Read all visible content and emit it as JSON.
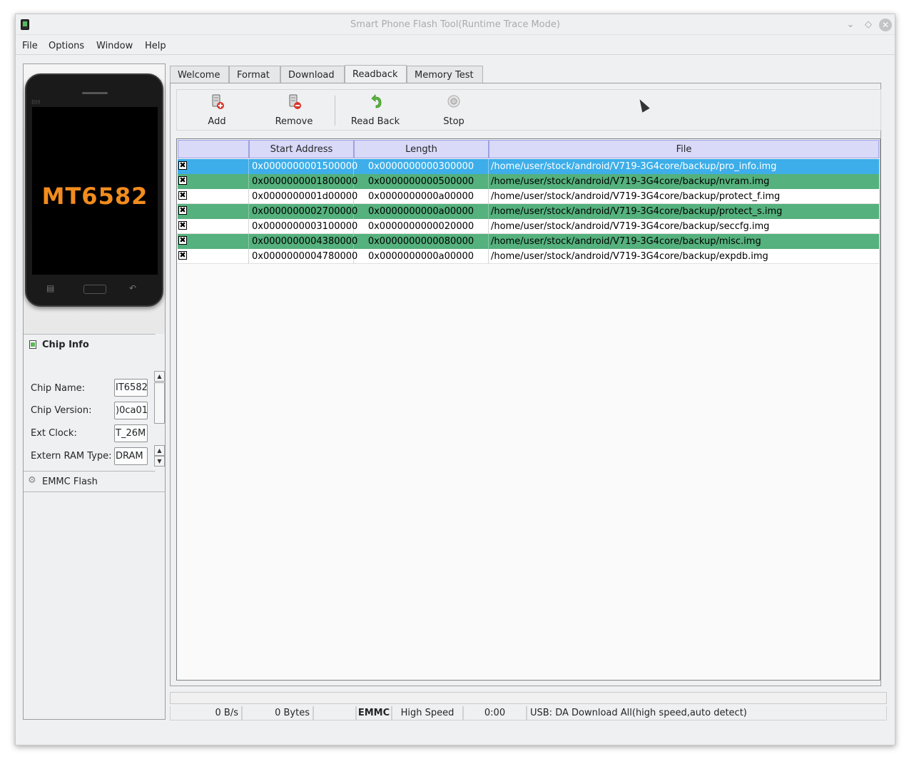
{
  "window": {
    "title": "Smart Phone Flash Tool(Runtime Trace Mode)",
    "controls": [
      "minimize",
      "restore",
      "close"
    ]
  },
  "menu": [
    "File",
    "Options",
    "Window",
    "Help"
  ],
  "phone": {
    "model": "MT6582",
    "brand": "BM"
  },
  "chip_info": {
    "title": "Chip Info",
    "fields": [
      {
        "label": "Chip Name:",
        "value": "IT6582"
      },
      {
        "label": "Chip Version:",
        "value": ")0ca01"
      },
      {
        "label": "Ext Clock:",
        "value": "T_26M"
      },
      {
        "label": "Extern RAM Type:",
        "value": "DRAM"
      }
    ]
  },
  "emmc": {
    "title": "EMMC Flash"
  },
  "tabs": [
    "Welcome",
    "Format",
    "Download",
    "Readback",
    "Memory Test"
  ],
  "active_tab": "Readback",
  "toolbar": {
    "add": "Add",
    "remove": "Remove",
    "read_back": "Read Back",
    "stop": "Stop"
  },
  "table": {
    "columns": [
      "",
      "Start Address",
      "Length",
      "File"
    ],
    "rows": [
      {
        "checked": true,
        "start": "0x0000000001500000",
        "length": "0x0000000000300000",
        "file": "/home/user/stock/android/V719-3G4core/backup/pro_info.img"
      },
      {
        "checked": true,
        "start": "0x0000000001800000",
        "length": "0x0000000000500000",
        "file": "/home/user/stock/android/V719-3G4core/backup/nvram.img"
      },
      {
        "checked": true,
        "start": "0x0000000001d00000",
        "length": "0x0000000000a00000",
        "file": "/home/user/stock/android/V719-3G4core/backup/protect_f.img"
      },
      {
        "checked": true,
        "start": "0x0000000002700000",
        "length": "0x0000000000a00000",
        "file": "/home/user/stock/android/V719-3G4core/backup/protect_s.img"
      },
      {
        "checked": true,
        "start": "0x0000000003100000",
        "length": "0x0000000000020000",
        "file": "/home/user/stock/android/V719-3G4core/backup/seccfg.img"
      },
      {
        "checked": true,
        "start": "0x0000000004380000",
        "length": "0x0000000000080000",
        "file": "/home/user/stock/android/V719-3G4core/backup/misc.img"
      },
      {
        "checked": true,
        "start": "0x0000000004780000",
        "length": "0x0000000000a00000",
        "file": "/home/user/stock/android/V719-3G4core/backup/expdb.img"
      }
    ]
  },
  "status": {
    "speed": "0 B/s",
    "bytes": "0 Bytes",
    "storage": "EMMC",
    "mode": "High Speed",
    "time": "0:00",
    "message": "USB: DA Download All(high speed,auto detect)"
  },
  "colors": {
    "selected": "#3daee9",
    "green_row": "#55b17d",
    "header": "#d9d9f8",
    "chip_model": "#f28c1e"
  }
}
